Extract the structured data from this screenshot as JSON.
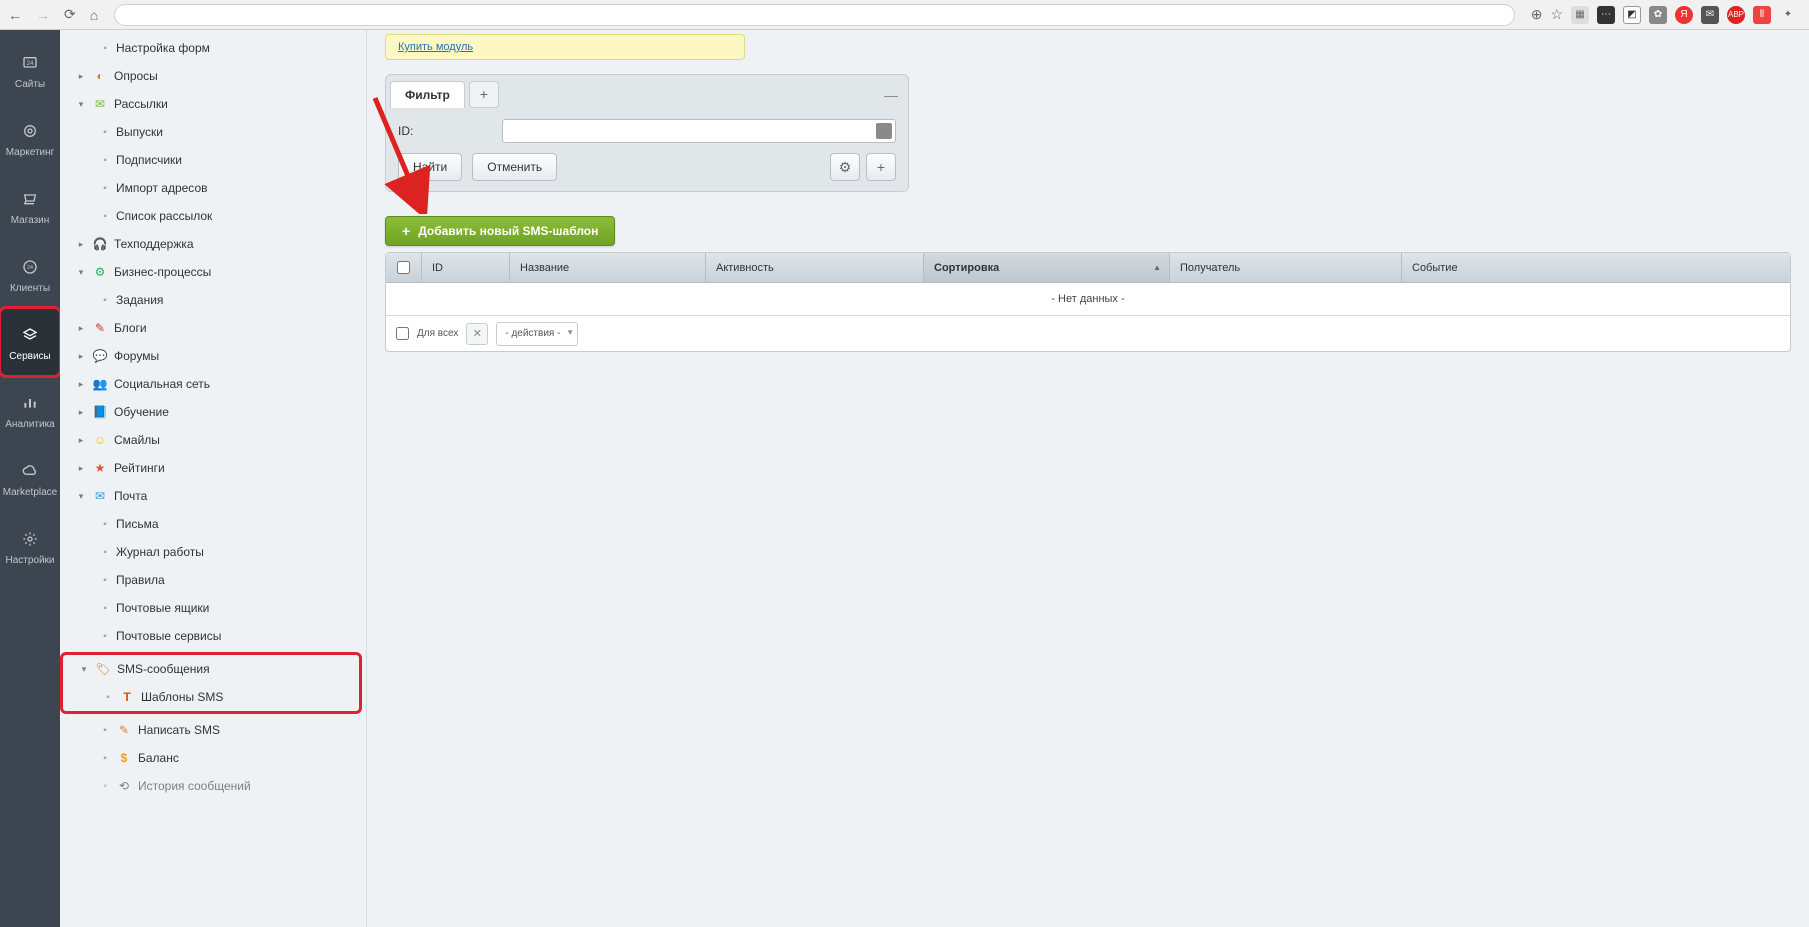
{
  "browser": {
    "back": "←",
    "forward": "→",
    "reload": "⟳",
    "home": "⌂",
    "search_icon": "⊕",
    "star": "☆"
  },
  "dark_sidebar": [
    {
      "label": "Сайты",
      "icon": "24"
    },
    {
      "label": "Маркетинг",
      "icon": "◎"
    },
    {
      "label": "Магазин",
      "icon": "🛒"
    },
    {
      "label": "Клиенты",
      "icon": "24"
    },
    {
      "label": "Сервисы",
      "icon": "≡"
    },
    {
      "label": "Аналитика",
      "icon": "⇑"
    },
    {
      "label": "Marketplace",
      "icon": "☁"
    },
    {
      "label": "Настройки",
      "icon": "⚙"
    }
  ],
  "tree": {
    "nastroika_form": "Настройка форм",
    "oprosy": "Опросы",
    "rassylki": "Рассылки",
    "vypuski": "Выпуски",
    "podpischiki": "Подписчики",
    "import_adresov": "Импорт адресов",
    "spisok_rassylok": "Список рассылок",
    "tehpodderzhka": "Техподдержка",
    "biznes_processy": "Бизнес-процессы",
    "zadaniya": "Задания",
    "blogi": "Блоги",
    "forumy": "Форумы",
    "socseti": "Социальная сеть",
    "obuchenie": "Обучение",
    "smayly": "Смайлы",
    "reytingi": "Рейтинги",
    "pochta": "Почта",
    "pisma": "Письма",
    "zhurnal": "Журнал работы",
    "pravila": "Правила",
    "pocht_yashiki": "Почтовые ящики",
    "pocht_servisy": "Почтовые сервисы",
    "sms_soobsch": "SMS-сообщения",
    "shablony_sms": "Шаблоны SMS",
    "napisat_sms": "Написать SMS",
    "balans": "Баланс",
    "istoriya": "История сообщений"
  },
  "warn_link": "Купить модуль",
  "filter": {
    "tab": "Фильтр",
    "id_label": "ID:",
    "find": "Найти",
    "cancel": "Отменить"
  },
  "add_button": "Добавить новый SMS-шаблон",
  "grid": {
    "cols": {
      "id": "ID",
      "name": "Название",
      "act": "Активность",
      "sort": "Сортировка",
      "recv": "Получатель",
      "event": "Событие"
    },
    "empty": "- Нет данных -",
    "for_all": "Для всех",
    "actions": "- действия -"
  }
}
